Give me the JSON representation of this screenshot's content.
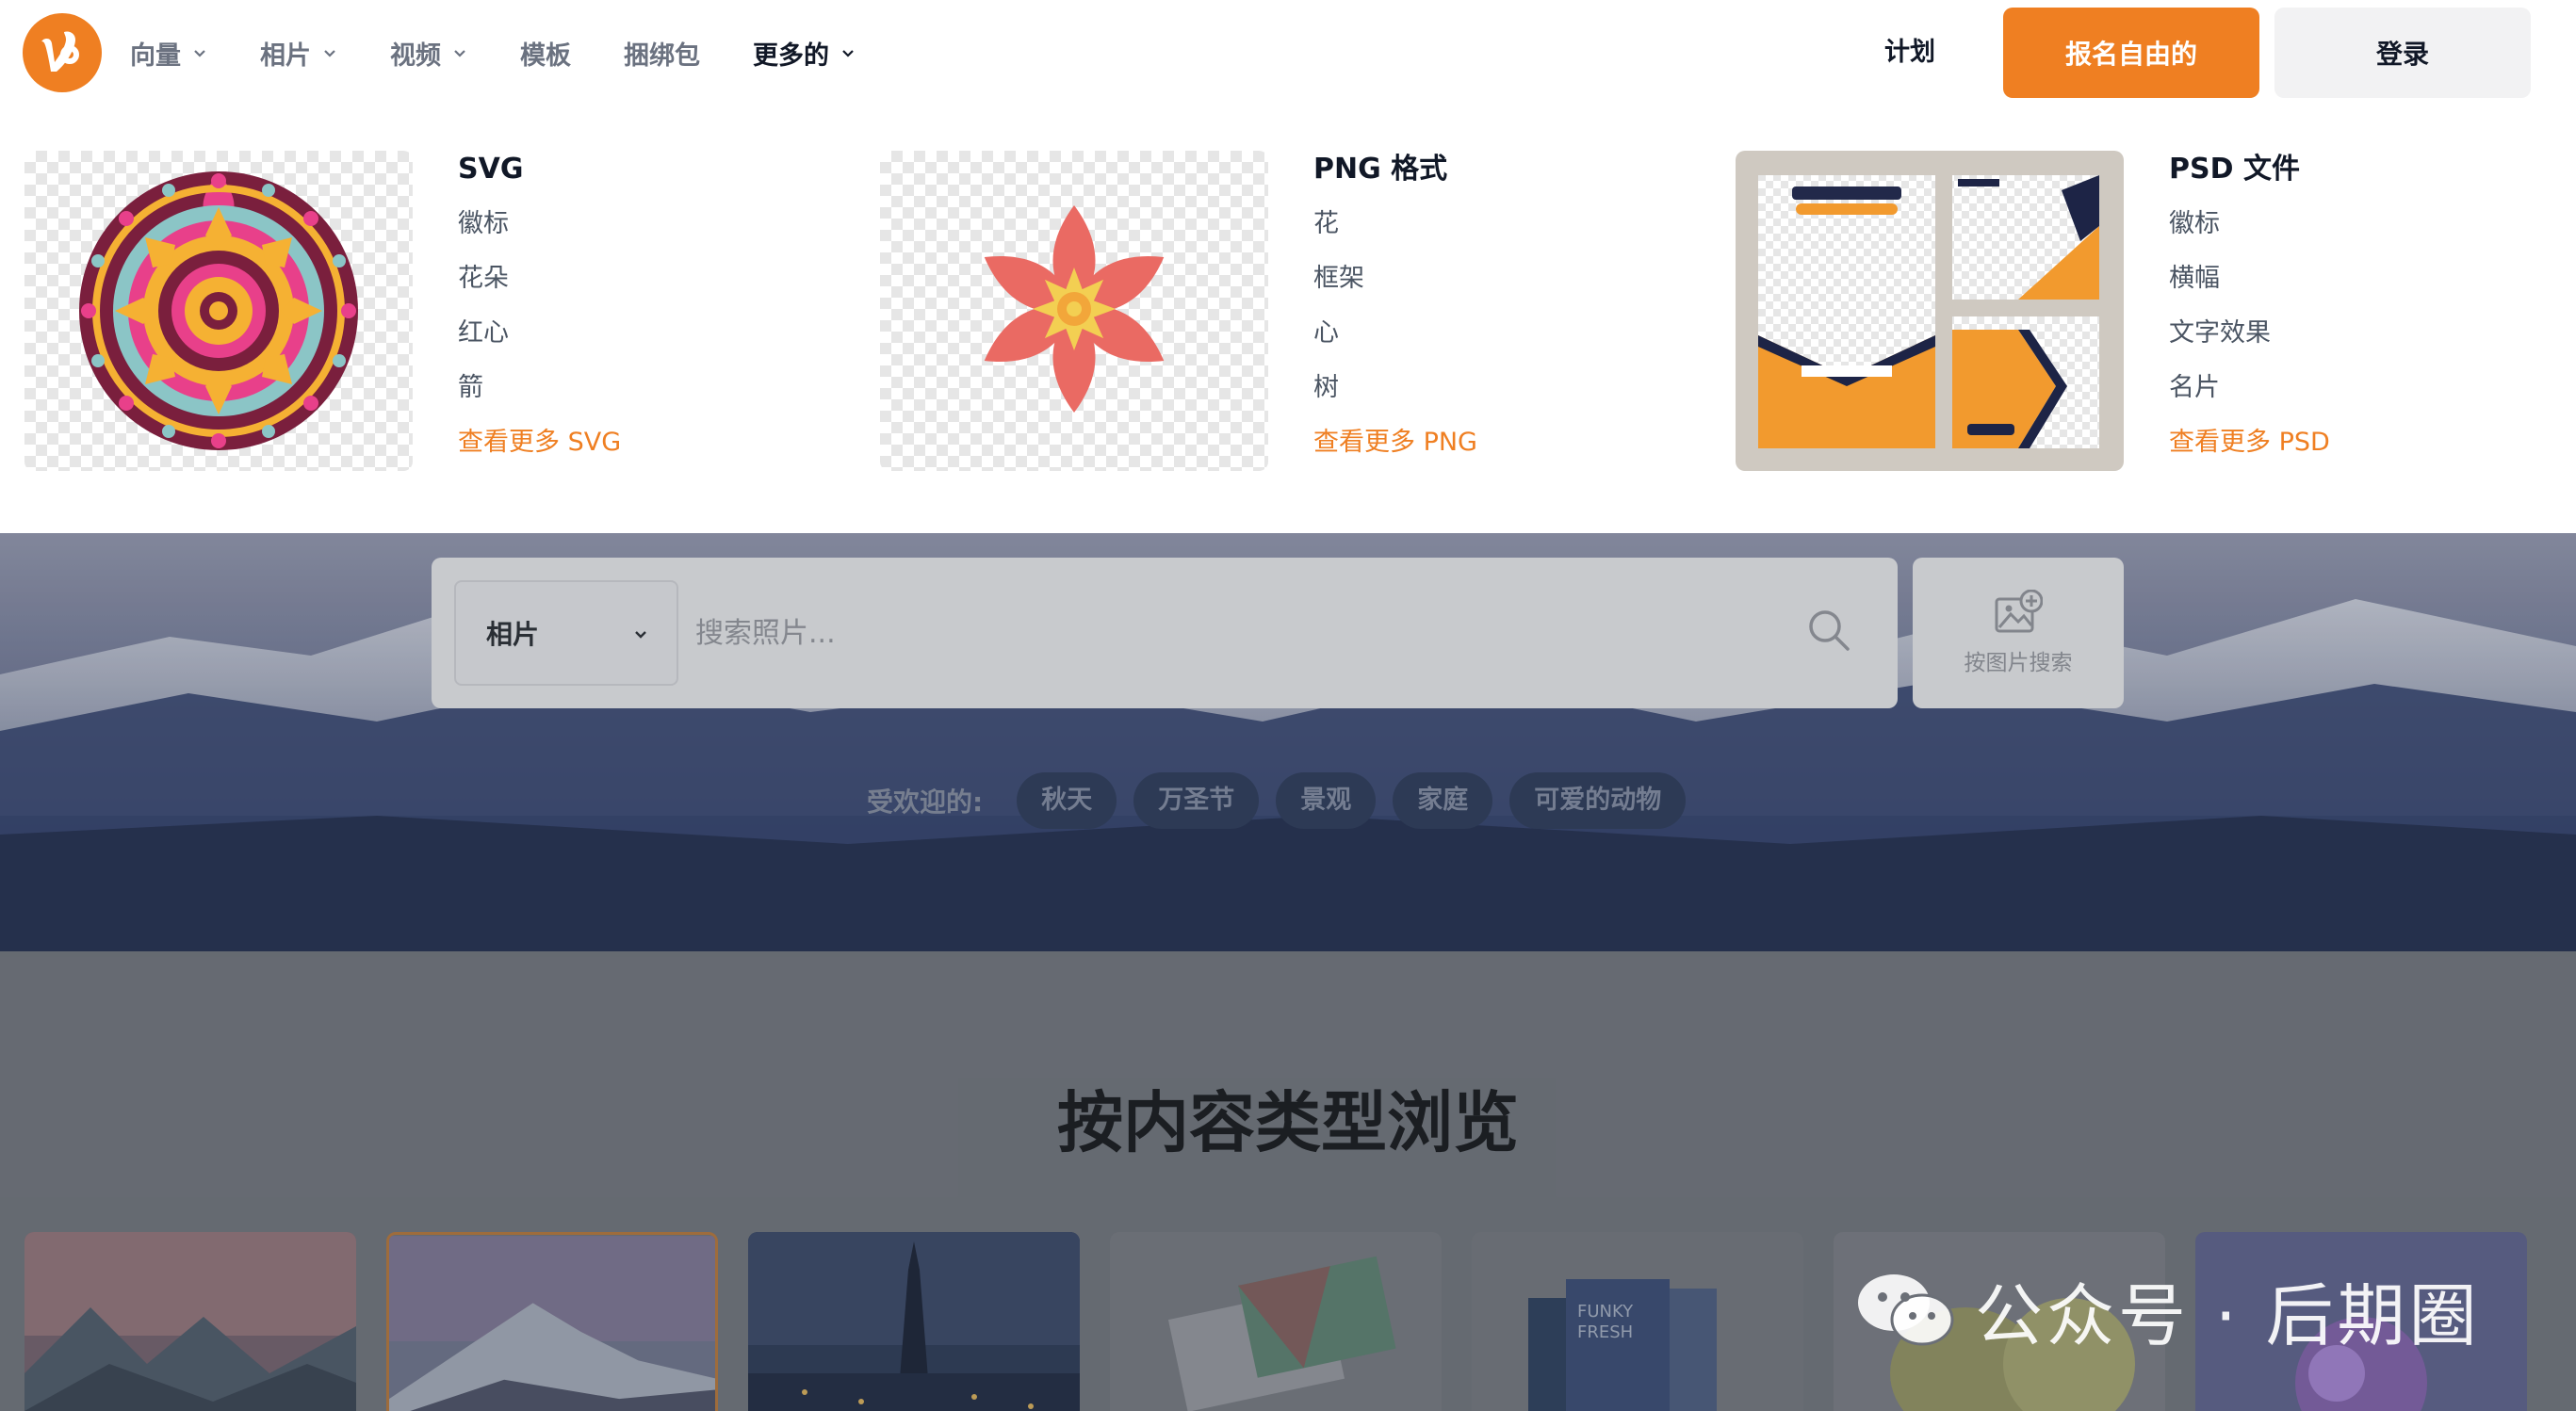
{
  "header": {
    "nav": [
      {
        "label": "向量",
        "has_dropdown": true,
        "active": false
      },
      {
        "label": "相片",
        "has_dropdown": true,
        "active": false
      },
      {
        "label": "视频",
        "has_dropdown": true,
        "active": false
      },
      {
        "label": "模板",
        "has_dropdown": false,
        "active": false
      },
      {
        "label": "捆绑包",
        "has_dropdown": false,
        "active": false
      },
      {
        "label": "更多的",
        "has_dropdown": true,
        "active": true
      }
    ],
    "plan_label": "计划",
    "signup_label": "报名自由的",
    "login_label": "登录",
    "accent_color": "#ef7f22"
  },
  "dropdown": {
    "groups": [
      {
        "title": "SVG",
        "items": [
          "徽标",
          "花朵",
          "红心",
          "箭"
        ],
        "more": "查看更多 SVG",
        "thumb": "mandala-illustration"
      },
      {
        "title": "PNG 格式",
        "items": [
          "花",
          "框架",
          "心",
          "树"
        ],
        "more": "查看更多 PNG",
        "thumb": "flower-illustration"
      },
      {
        "title": "PSD 文件",
        "items": [
          "徽标",
          "横幅",
          "文字效果",
          "名片"
        ],
        "more": "查看更多 PSD",
        "thumb": "poster-templates"
      }
    ]
  },
  "search": {
    "type_selected": "相片",
    "placeholder": "搜索照片...",
    "image_search_label": "按图片搜索"
  },
  "popular": {
    "label": "受欢迎的:",
    "tags": [
      "秋天",
      "万圣节",
      "景观",
      "家庭",
      "可爱的动物"
    ]
  },
  "browse": {
    "title": "按内容类型浏览"
  },
  "watermark": {
    "text": "公众号 · 后期圈"
  }
}
